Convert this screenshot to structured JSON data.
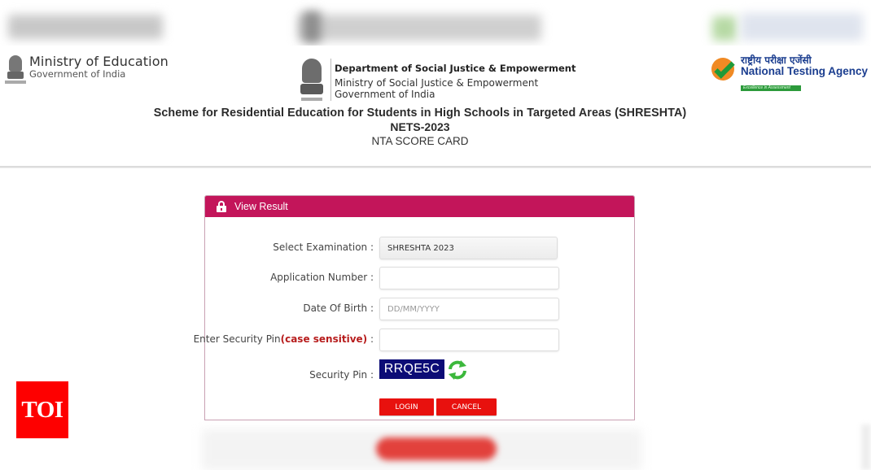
{
  "header": {
    "moe": {
      "title": "Ministry of Education",
      "subtitle": "Government of India"
    },
    "dsje": {
      "line1": "Department of Social Justice & Empowerment",
      "line2": "Ministry of Social Justice & Empowerment",
      "line3": "Government of India"
    },
    "nta": {
      "hindi": "राष्ट्रीय परीक्षा एजेंसी",
      "english": "National Testing Agency",
      "tagline": "Excellence in Assessment"
    },
    "title": "Scheme for Residential Education for Students in High Schools in Targeted Areas (SHRESHTA)",
    "subtitle": "NETS-2023",
    "card_label": "NTA SCORE CARD"
  },
  "panel": {
    "title": "View Result",
    "fields": {
      "exam": {
        "label": "Select Examination :",
        "value": "SHRESHTA 2023"
      },
      "application": {
        "label": "Application Number :",
        "value": "",
        "placeholder": ""
      },
      "dob": {
        "label": "Date Of Birth :",
        "value": "",
        "placeholder": "DD/MM/YYYY"
      },
      "pin_input": {
        "label_main": "Enter Security Pin",
        "label_note": "(case sensitive)",
        "label_suffix": " :",
        "value": "",
        "placeholder": ""
      },
      "captcha": {
        "label": "Security Pin :",
        "code": "RRQE5C"
      }
    },
    "buttons": {
      "login": "LOGIN",
      "cancel": "CANCEL"
    }
  },
  "watermark": {
    "text": "TOI"
  },
  "colors": {
    "panel_header": "#c3155a",
    "button": "#e8110e",
    "captcha_bg": "#0c0c76",
    "refresh": "#3cb83c",
    "toi": "#fe0000"
  }
}
